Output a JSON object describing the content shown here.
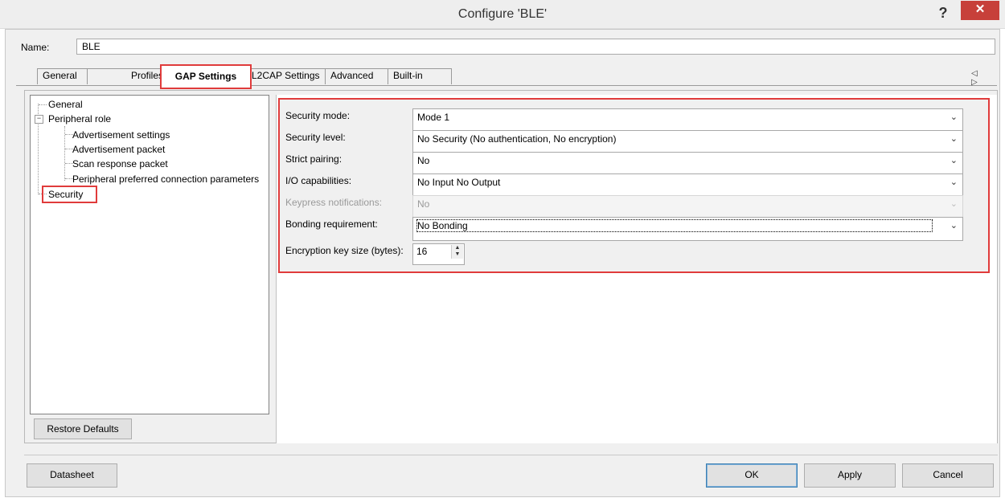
{
  "window": {
    "title": "Configure 'BLE'",
    "help": "?",
    "close": "✕"
  },
  "name_field": {
    "label": "Name:",
    "value": "BLE"
  },
  "tabs": [
    {
      "label": "General"
    },
    {
      "label": "Profiles"
    },
    {
      "label": "GAP Settings",
      "active": true
    },
    {
      "label": "L2CAP Settings"
    },
    {
      "label": "Advanced"
    },
    {
      "label": "Built-in"
    }
  ],
  "tab_scroll": "◁ ▷",
  "tree": {
    "general": "General",
    "peripheral_role": "Peripheral role",
    "children": [
      "Advertisement settings",
      "Advertisement packet",
      "Scan response packet",
      "Peripheral preferred connection parameters"
    ],
    "security": "Security"
  },
  "restore_defaults": "Restore Defaults",
  "settings": {
    "security_mode": {
      "label": "Security mode:",
      "value": "Mode 1"
    },
    "security_level": {
      "label": "Security level:",
      "value": "No Security (No authentication, No encryption)"
    },
    "strict_pairing": {
      "label": "Strict pairing:",
      "value": "No"
    },
    "io_capabilities": {
      "label": "I/O capabilities:",
      "value": "No Input No Output"
    },
    "keypress": {
      "label": "Keypress notifications:",
      "value": "No"
    },
    "bonding": {
      "label": "Bonding requirement:",
      "value": "No Bonding"
    },
    "enc_key": {
      "label": "Encryption key size (bytes):",
      "value": "16"
    }
  },
  "footer": {
    "datasheet": "Datasheet",
    "ok": "OK",
    "apply": "Apply",
    "cancel": "Cancel"
  },
  "colors": {
    "highlight": "#e03b3b",
    "close_button": "#c7403a"
  }
}
